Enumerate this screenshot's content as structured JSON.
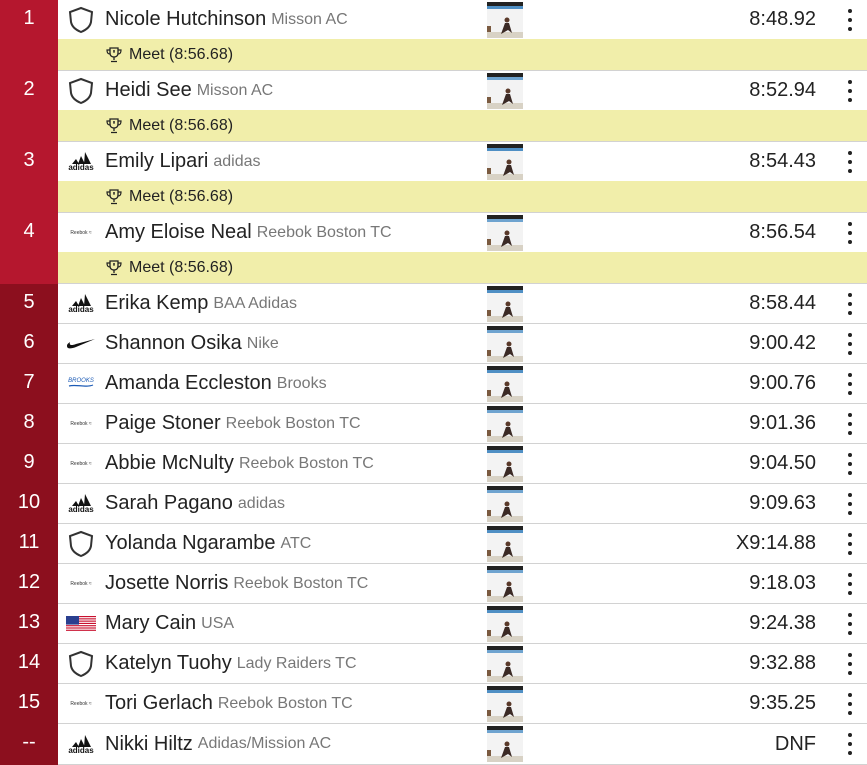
{
  "rows": [
    {
      "place": "1",
      "name": "Nicole Hutchinson",
      "team": "Misson AC",
      "mark": "8:48.92",
      "logo": "shield-icon",
      "record": "Meet (8:56.68)"
    },
    {
      "place": "2",
      "name": "Heidi See",
      "team": "Misson AC",
      "mark": "8:52.94",
      "logo": "shield-icon",
      "record": "Meet (8:56.68)"
    },
    {
      "place": "3",
      "name": "Emily Lipari",
      "team": "adidas",
      "mark": "8:54.43",
      "logo": "adidas-logo",
      "record": "Meet (8:56.68)"
    },
    {
      "place": "4",
      "name": "Amy Eloise Neal",
      "team": "Reebok Boston TC",
      "mark": "8:56.54",
      "logo": "reebok-logo",
      "record": "Meet (8:56.68)"
    },
    {
      "place": "5",
      "name": "Erika Kemp",
      "team": "BAA Adidas",
      "mark": "8:58.44",
      "logo": "adidas-logo",
      "record": ""
    },
    {
      "place": "6",
      "name": "Shannon Osika",
      "team": "Nike",
      "mark": "9:00.42",
      "logo": "nike-logo",
      "record": ""
    },
    {
      "place": "7",
      "name": "Amanda Eccleston",
      "team": "Brooks",
      "mark": "9:00.76",
      "logo": "brooks-logo",
      "record": ""
    },
    {
      "place": "8",
      "name": "Paige Stoner",
      "team": "Reebok Boston TC",
      "mark": "9:01.36",
      "logo": "reebok-logo",
      "record": ""
    },
    {
      "place": "9",
      "name": "Abbie McNulty",
      "team": "Reebok Boston TC",
      "mark": "9:04.50",
      "logo": "reebok-logo",
      "record": ""
    },
    {
      "place": "10",
      "name": "Sarah Pagano",
      "team": "adidas",
      "mark": "9:09.63",
      "logo": "adidas-logo",
      "record": ""
    },
    {
      "place": "11",
      "name": "Yolanda Ngarambe",
      "team": "ATC",
      "mark": "X9:14.88",
      "logo": "shield-icon",
      "record": ""
    },
    {
      "place": "12",
      "name": "Josette Norris",
      "team": "Reebok Boston TC",
      "mark": "9:18.03",
      "logo": "reebok-logo",
      "record": ""
    },
    {
      "place": "13",
      "name": "Mary Cain",
      "team": "USA",
      "mark": "9:24.38",
      "logo": "us-flag-icon",
      "record": ""
    },
    {
      "place": "14",
      "name": "Katelyn Tuohy",
      "team": "Lady Raiders TC",
      "mark": "9:32.88",
      "logo": "shield-icon",
      "record": ""
    },
    {
      "place": "15",
      "name": "Tori Gerlach",
      "team": "Reebok Boston TC",
      "mark": "9:35.25",
      "logo": "reebok-logo",
      "record": ""
    },
    {
      "place": "--",
      "name": "Nikki Hiltz",
      "team": "Adidas/Mission AC",
      "mark": "DNF",
      "logo": "adidas-logo",
      "record": ""
    }
  ],
  "brand_text": {
    "adidas": "adidas",
    "reebok": "Reebok ≈",
    "brooks": "BROOKS"
  },
  "colors": {
    "place_dark": "#8c0f1e",
    "place_light": "#b5172e",
    "record_bg": "#f1eeaa"
  }
}
